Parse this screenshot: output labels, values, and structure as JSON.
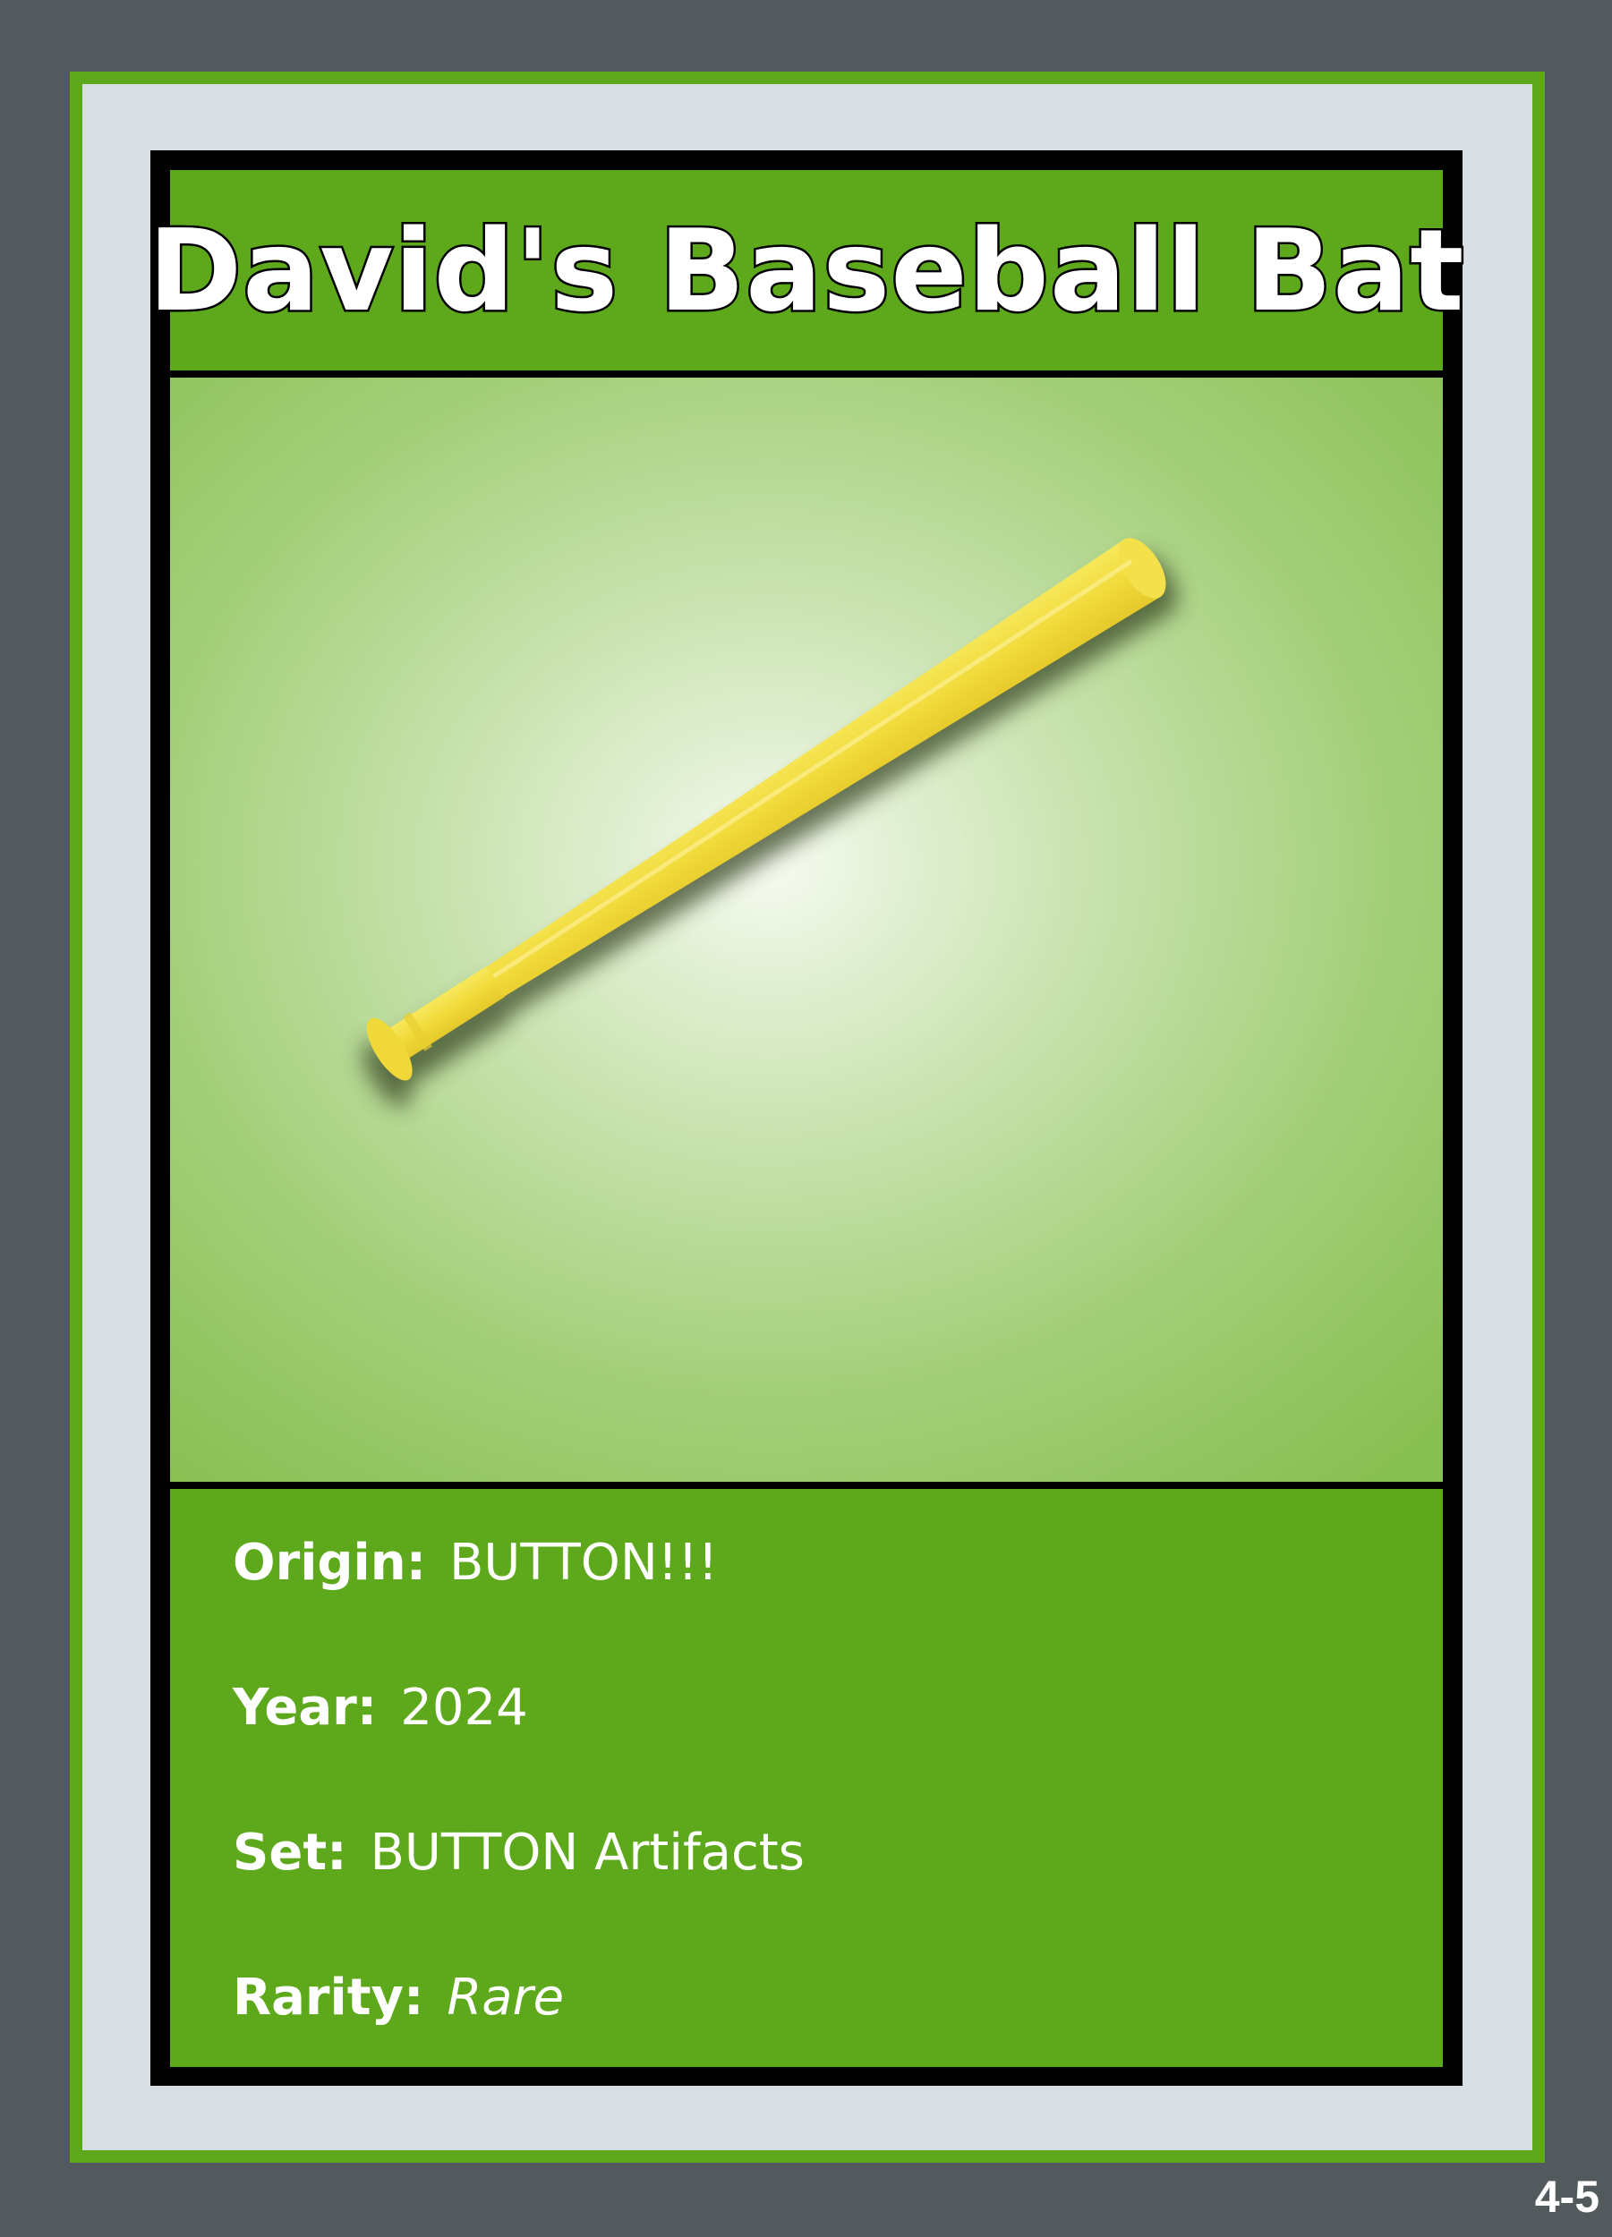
{
  "card": {
    "title": "David's Baseball Bat",
    "image_subject": "baseball-bat",
    "fields": [
      {
        "label": "Origin:",
        "value": "BUTTON!!!"
      },
      {
        "label": "Year:",
        "value": "2024"
      },
      {
        "label": "Set:",
        "value": "BUTTON Artifacts"
      },
      {
        "label": "Rarity:",
        "value": "Rare"
      }
    ],
    "card_number": "4-5"
  },
  "colors": {
    "background": "#535a5d",
    "accent_green": "#5ea81b",
    "mat": "#d7dfe5",
    "border": "#000000",
    "bat_yellow": "#f2dd3c",
    "text": "#ffffff"
  }
}
